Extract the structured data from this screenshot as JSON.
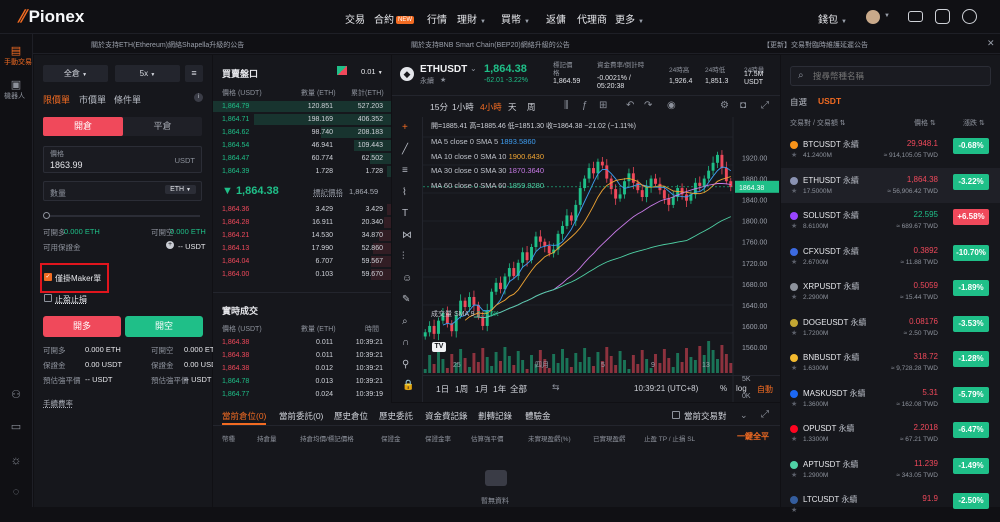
{
  "brand": {
    "name": "Pionex",
    "accent": "#f26b22"
  },
  "nav": {
    "trade": "交易",
    "futures": "合約",
    "futures_badge": "NEW",
    "markets": "行情",
    "finance": "理財",
    "buy": "買幣",
    "rebate": "返傭",
    "agent": "代理商",
    "more": "更多",
    "wallet": "錢包"
  },
  "announcements": [
    "關於支持ETH(Ethereum)網絡Shapella升級的公告",
    "關於支持BNB Smart Chain(BEP20)網絡升級的公告",
    "【更新】交易對臨時維護延遲公告"
  ],
  "left_sidebar": {
    "manual_trade": "手動交易",
    "bots": "機器人"
  },
  "order_panel": {
    "margin_mode": "全倉",
    "leverage": "5x",
    "tabs": [
      "限價單",
      "市價單",
      "條件單"
    ],
    "open": "開倉",
    "close": "平倉",
    "price_label": "價格",
    "price_value": "1863.99",
    "price_unit": "USDT",
    "qty_label": "數量",
    "qty_unit": "ETH",
    "can_buy_label": "可開多",
    "can_buy_value": "0.000 ETH",
    "can_sell_label": "可開空",
    "can_sell_value": "0.000 ETH",
    "available_label": "可用保證金",
    "available_value": "-- USDT",
    "maker_only": "僅掛Maker單",
    "tp_sl": "止盈止損",
    "long": "開多",
    "short": "開空",
    "info": [
      [
        "可開多",
        "0.000 ETH",
        "可開空",
        "0.000 ETH"
      ],
      [
        "保證金",
        "0.00 USDT",
        "保證金",
        "0.00 USDT"
      ],
      [
        "預估強平價",
        "-- USDT",
        "預估強平價",
        "-- USDT"
      ]
    ],
    "manual": "手續費率"
  },
  "order_book": {
    "title": "買賣盤口",
    "precision": "0.01",
    "headers": [
      "價格 (USDT)",
      "數量 (ETH)",
      "累計(ETH)"
    ],
    "top_rows": [
      [
        "1,864.79",
        "120.851",
        "527.203"
      ],
      [
        "1,864.71",
        "198.169",
        "406.352"
      ],
      [
        "1,864.62",
        "98.740",
        "208.183"
      ],
      [
        "1,864.54",
        "46.941",
        "109.443"
      ],
      [
        "1,864.47",
        "60.774",
        "62.502"
      ],
      [
        "1,864.39",
        "1.728",
        "1.728"
      ]
    ],
    "mid_price": "▼ 1,864.38",
    "mark_label": "標記價格",
    "mark_value": "1,864.59",
    "bottom_rows": [
      [
        "1,864.36",
        "3.429",
        "3.429"
      ],
      [
        "1,864.28",
        "16.911",
        "20.340"
      ],
      [
        "1,864.21",
        "14.530",
        "34.870"
      ],
      [
        "1,864.13",
        "17.990",
        "52.860"
      ],
      [
        "1,864.04",
        "6.707",
        "59.567"
      ],
      [
        "1,864.00",
        "0.103",
        "59.670"
      ]
    ],
    "trades_title": "實時成交",
    "trades_headers": [
      "價格 (USDT)",
      "數量 (ETH)",
      "時間"
    ],
    "trades": [
      [
        "1,864.38",
        "0.011",
        "10:39:21",
        "red"
      ],
      [
        "1,864.38",
        "0.011",
        "10:39:21",
        "red"
      ],
      [
        "1,864.38",
        "0.012",
        "10:39:21",
        "red"
      ],
      [
        "1,864.78",
        "0.013",
        "10:39:21",
        "green"
      ],
      [
        "1,864.77",
        "0.024",
        "10:39:19",
        "green"
      ]
    ]
  },
  "ticker": {
    "symbol": "ETHUSDT",
    "sub": "永續",
    "price": "1,864.38",
    "change": "-62.01 -3.22%",
    "mark_label": "標記價格",
    "mark": "1,864.59",
    "funding_label": "資金費率/倒計時",
    "funding": "-0.0021% / 05:20:38",
    "high_label": "24時高",
    "high": "1,926.4",
    "low_label": "24時低",
    "low": "1,851.3",
    "vol_label": "24時量",
    "vol": "17.5M USDT"
  },
  "chart_toolbar": {
    "intervals": [
      "15分",
      "1小時",
      "4小時",
      "天",
      "周"
    ],
    "active": "4小時"
  },
  "chart_data": {
    "type": "candlestick",
    "ohlc_line": "開=1885.41 高=1885.46 低=1851.30 收=1864.38 −21.02 (−1.11%)",
    "ma": [
      {
        "name": "MA 5 close 0 SMA 5",
        "value": "1893.5860",
        "color": "#3e9df0"
      },
      {
        "name": "MA 10 close 0 SMA 10",
        "value": "1900.6430",
        "color": "#f0a533"
      },
      {
        "name": "MA 30 close 0 SMA 30",
        "value": "1870.3640",
        "color": "#c77ae6"
      },
      {
        "name": "MA 60 close 0 SMA 60",
        "value": "1859.9280",
        "color": "#4fd1a5"
      }
    ],
    "y_ticks": [
      "1920.00",
      "1880.00",
      "1864.38",
      "1840.00",
      "1800.00",
      "1760.00",
      "1720.00",
      "1680.00",
      "1640.00",
      "1600.00",
      "1560.00"
    ],
    "ylim": [
      1540,
      1960
    ],
    "x_ticks": [
      "25",
      "四月",
      "5",
      "9",
      "13"
    ],
    "last_price": 1864.38,
    "closes": [
      1588,
      1600,
      1585,
      1610,
      1625,
      1605,
      1590,
      1620,
      1648,
      1636,
      1655,
      1640,
      1618,
      1600,
      1630,
      1665,
      1682,
      1670,
      1694,
      1710,
      1695,
      1720,
      1740,
      1725,
      1750,
      1770,
      1760,
      1752,
      1738,
      1745,
      1775,
      1790,
      1810,
      1800,
      1830,
      1862,
      1880,
      1900,
      1890,
      1912,
      1905,
      1880,
      1860,
      1842,
      1850,
      1875,
      1890,
      1872,
      1858,
      1845,
      1865,
      1880,
      1870,
      1858,
      1842,
      1830,
      1845,
      1862,
      1850,
      1838,
      1850,
      1872,
      1866,
      1880,
      1895,
      1910,
      1925,
      1900,
      1875,
      1864
    ],
    "volume_label": "成交量 SMA 9",
    "volume_value": "2.716K",
    "vol_ticks": [
      "5K",
      "0K"
    ],
    "ranges": [
      "1日",
      "1周",
      "1月",
      "1年",
      "全部"
    ],
    "time": "10:39:21 (UTC+8)",
    "scale_pct": "%",
    "scale_log": "log",
    "scale_auto": "自動"
  },
  "bottom_tabs": {
    "tabs": [
      "當前倉位(0)",
      "當前委託(0)",
      "歷史倉位",
      "歷史委託",
      "資金費記錄",
      "劃轉記錄",
      "體驗金"
    ],
    "current_pair": "當前交易對",
    "columns": [
      "幣種",
      "持倉量",
      "持倉均價/標記價格",
      "保證金",
      "保證金率",
      "估算強平價",
      "未實現盈虧(%)",
      "已實現盈虧",
      "止盈 TP / 止損 SL"
    ],
    "close_all": "一鍵全平",
    "empty": "暫無資料"
  },
  "market": {
    "search_placeholder": "搜尋幣種名稱",
    "tabs": [
      "自選",
      "USDT"
    ],
    "headers": [
      "交易對 / 交易額",
      "價格",
      "漲跌"
    ],
    "rows": [
      {
        "name": "BTCUSDT",
        "tag": "永續",
        "vol": "41.2400M",
        "price": "29,948.1",
        "sub": "≈ 914,105.05 TWD",
        "chg": "-0.68%",
        "up": false,
        "color": "#f7931a"
      },
      {
        "name": "ETHUSDT",
        "tag": "永續",
        "vol": "17.5000M",
        "price": "1,864.38",
        "sub": "≈ 56,906.42 TWD",
        "chg": "-3.22%",
        "up": false,
        "color": "#8a92b2"
      },
      {
        "name": "SOLUSDT",
        "tag": "永續",
        "vol": "8.6100M",
        "price": "22.595",
        "sub": "≈ 689.67 TWD",
        "chg": "+6.58%",
        "up": true,
        "color": "#9945ff"
      },
      {
        "name": "CFXUSDT",
        "tag": "永續",
        "vol": "2.6700M",
        "price": "0.3892",
        "sub": "≈ 11.88 TWD",
        "chg": "-10.70%",
        "up": false,
        "color": "#3c6ae0"
      },
      {
        "name": "XRPUSDT",
        "tag": "永續",
        "vol": "2.2900M",
        "price": "0.5059",
        "sub": "≈ 15.44 TWD",
        "chg": "-1.89%",
        "up": false,
        "color": "#8d929c"
      },
      {
        "name": "DOGEUSDT",
        "tag": "永續",
        "vol": "1.7200M",
        "price": "0.08176",
        "sub": "≈ 2.50 TWD",
        "chg": "-3.53%",
        "up": false,
        "color": "#c2a633"
      },
      {
        "name": "BNBUSDT",
        "tag": "永續",
        "vol": "1.6300M",
        "price": "318.72",
        "sub": "≈ 9,728.28 TWD",
        "chg": "-1.28%",
        "up": false,
        "color": "#f3ba2f"
      },
      {
        "name": "MASKUSDT",
        "tag": "永續",
        "vol": "1.3600M",
        "price": "5.31",
        "sub": "≈ 162.08 TWD",
        "chg": "-5.79%",
        "up": false,
        "color": "#1c68f3"
      },
      {
        "name": "OPUSDT",
        "tag": "永續",
        "vol": "1.3300M",
        "price": "2.2018",
        "sub": "≈ 67.21 TWD",
        "chg": "-6.47%",
        "up": false,
        "color": "#ff0420"
      },
      {
        "name": "APTUSDT",
        "tag": "永續",
        "vol": "1.2900M",
        "price": "11.239",
        "sub": "≈ 343.05 TWD",
        "chg": "-1.49%",
        "up": false,
        "color": "#4fd1a5"
      },
      {
        "name": "LTCUSDT",
        "tag": "永續",
        "vol": "",
        "price": "91.9",
        "sub": "",
        "chg": "-2.50%",
        "up": false,
        "color": "#345d9d"
      }
    ]
  },
  "colors": {
    "up": "#1fbf88",
    "down": "#f0495b",
    "bg": "#101014",
    "panel": "#16171c"
  }
}
